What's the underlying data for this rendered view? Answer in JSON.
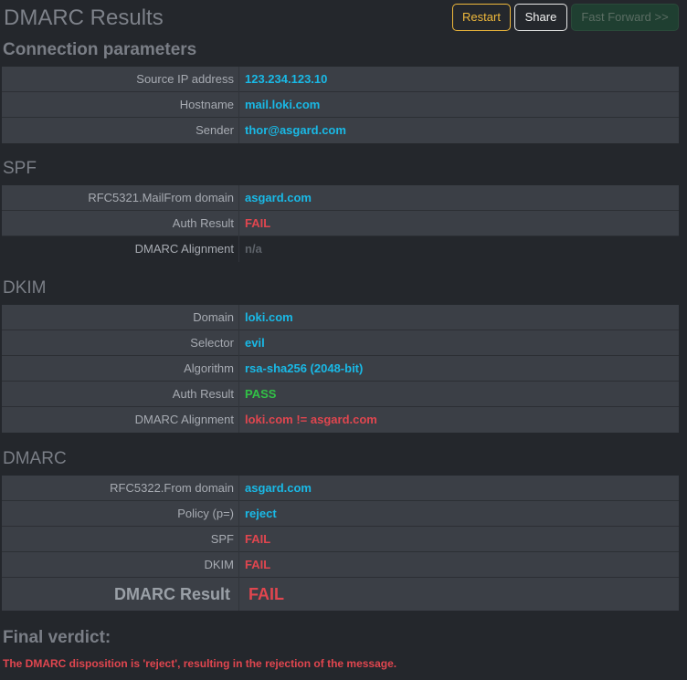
{
  "title": "DMARC Results",
  "buttons": {
    "restart": "Restart",
    "share": "Share",
    "fast_forward": "Fast Forward >>"
  },
  "connection": {
    "heading": "Connection parameters",
    "rows": [
      {
        "label": "Source IP address",
        "value": "123.234.123.10"
      },
      {
        "label": "Hostname",
        "value": "mail.loki.com"
      },
      {
        "label": "Sender",
        "value": "thor@asgard.com"
      }
    ]
  },
  "spf": {
    "heading": "SPF",
    "rows": [
      {
        "label": "RFC5321.MailFrom domain",
        "value": "asgard.com"
      },
      {
        "label": "Auth Result",
        "value": "FAIL"
      },
      {
        "label": "DMARC Alignment",
        "value": "n/a"
      }
    ]
  },
  "dkim": {
    "heading": "DKIM",
    "rows": [
      {
        "label": "Domain",
        "value": "loki.com"
      },
      {
        "label": "Selector",
        "value": "evil"
      },
      {
        "label": "Algorithm",
        "value": "rsa-sha256 (2048-bit)"
      },
      {
        "label": "Auth Result",
        "value": "PASS"
      },
      {
        "label": "DMARC Alignment",
        "value": "loki.com != asgard.com"
      }
    ]
  },
  "dmarc": {
    "heading": "DMARC",
    "rows": [
      {
        "label": "RFC5322.From domain",
        "value": "asgard.com"
      },
      {
        "label": "Policy (p=)",
        "value": "reject"
      },
      {
        "label": "SPF",
        "value": "FAIL"
      },
      {
        "label": "DKIM",
        "value": "FAIL"
      }
    ],
    "result_label": "DMARC Result",
    "result_value": "FAIL"
  },
  "verdict": {
    "heading": "Final verdict:",
    "text": "The DMARC disposition is 'reject', resulting in the rejection of the message."
  },
  "colors": {
    "background": "#24272c",
    "table": "#3b3f46",
    "info": "#19b9e6",
    "fail": "#e0464f",
    "pass": "#32c146",
    "warning": "#f0b93b"
  }
}
